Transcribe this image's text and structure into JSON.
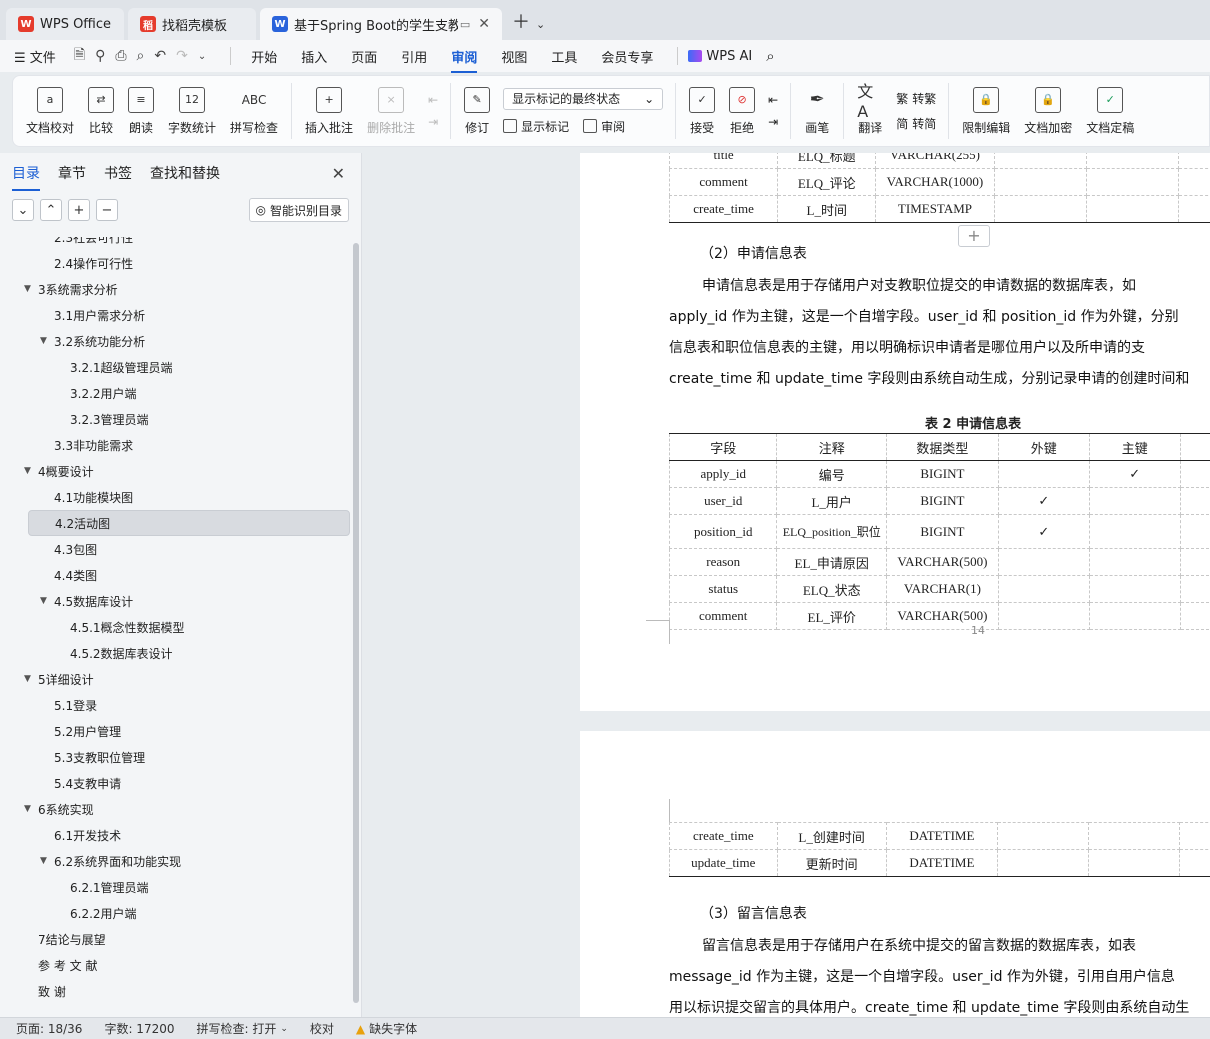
{
  "tabs": [
    {
      "label": "WPS Office",
      "logo": "W",
      "color": "#e53b2c"
    },
    {
      "label": "找稻壳模板",
      "logo": "稻",
      "color": "#e53b2c"
    },
    {
      "label": "基于Spring Boot的学生支教",
      "logo": "W",
      "color": "#2a63db"
    }
  ],
  "menu": {
    "file": "文件",
    "items": [
      "开始",
      "插入",
      "页面",
      "引用",
      "审阅",
      "视图",
      "工具",
      "会员专享"
    ],
    "active": "审阅",
    "ai": "WPS AI"
  },
  "ribbon": {
    "proofread": "文档校对",
    "compare": "比较",
    "read_aloud": "朗读",
    "word_count": "字数统计",
    "word_count_icon": "12",
    "spell_check": "拼写检查",
    "spell_icon": "ABC",
    "insert_comment": "插入批注",
    "delete_comment": "删除批注",
    "revise": "修订",
    "show_markup_select": "显示标记的最终状态",
    "show_markup": "显示标记",
    "review": "审阅",
    "accept": "接受",
    "reject": "拒绝",
    "pen": "画笔",
    "translate": "翻译",
    "to_traditional": "转繁",
    "to_simplified": "转简",
    "restrict_edit": "限制编辑",
    "encrypt": "文档加密",
    "finalize": "文档定稿"
  },
  "left_panel": {
    "tabs": [
      "目录",
      "章节",
      "书签",
      "查找和替换"
    ],
    "active": "目录",
    "smart_toc": "智能识别目录",
    "toc": [
      {
        "text": "2.3社会可行性",
        "level": 2
      },
      {
        "text": "2.4操作可行性",
        "level": 2
      },
      {
        "text": "3系统需求分析",
        "level": 1,
        "expanded": true
      },
      {
        "text": "3.1用户需求分析",
        "level": 2
      },
      {
        "text": "3.2系统功能分析",
        "level": 2,
        "expanded": true
      },
      {
        "text": "3.2.1超级管理员端",
        "level": 3
      },
      {
        "text": "3.2.2用户端",
        "level": 3
      },
      {
        "text": "3.2.3管理员端",
        "level": 3
      },
      {
        "text": "3.3非功能需求",
        "level": 2
      },
      {
        "text": "4概要设计",
        "level": 1,
        "expanded": true
      },
      {
        "text": "4.1功能模块图",
        "level": 2
      },
      {
        "text": "4.2活动图",
        "level": 2,
        "selected": true
      },
      {
        "text": "4.3包图",
        "level": 2
      },
      {
        "text": "4.4类图",
        "level": 2
      },
      {
        "text": "4.5数据库设计",
        "level": 2,
        "expanded": true
      },
      {
        "text": "4.5.1概念性数据模型",
        "level": 3
      },
      {
        "text": "4.5.2数据库表设计",
        "level": 3
      },
      {
        "text": "5详细设计",
        "level": 1,
        "expanded": true
      },
      {
        "text": "5.1登录",
        "level": 2
      },
      {
        "text": "5.2用户管理",
        "level": 2
      },
      {
        "text": "5.3支教职位管理",
        "level": 2
      },
      {
        "text": "5.4支教申请",
        "level": 2
      },
      {
        "text": "6系统实现",
        "level": 1,
        "expanded": true
      },
      {
        "text": "6.1开发技术",
        "level": 2
      },
      {
        "text": "6.2系统界面和功能实现",
        "level": 2,
        "expanded": true
      },
      {
        "text": "6.2.1管理员端",
        "level": 3
      },
      {
        "text": "6.2.2用户端",
        "level": 3
      },
      {
        "text": "7结论与展望",
        "level": 1
      },
      {
        "text": "参 考 文 献",
        "level": 1
      },
      {
        "text": "致        谢",
        "level": 1
      }
    ]
  },
  "document": {
    "table1_rows": [
      [
        "title",
        "ELQ_标题",
        "VARCHAR(255)"
      ],
      [
        "comment",
        "ELQ_评论",
        "VARCHAR(1000)"
      ],
      [
        "create_time",
        "L_时间",
        "TIMESTAMP"
      ]
    ],
    "section2_heading": "（2）申请信息表",
    "section2_para": [
      "申请信息表是用于存储用户对支教职位提交的申请数据的数据库表，如",
      "apply_id 作为主键，这是一个自增字段。user_id 和 position_id 作为外键，分别",
      "信息表和职位信息表的主键，用以明确标识申请者是哪位用户以及所申请的支",
      "create_time 和 update_time 字段则由系统自动生成，分别记录申请的创建时间和"
    ],
    "table2_caption": "表 2  申请信息表",
    "table2_headers": [
      "字段",
      "注释",
      "数据类型",
      "外键",
      "主键"
    ],
    "table2_rows": [
      [
        "apply_id",
        "编号",
        "BIGINT",
        "",
        "✓"
      ],
      [
        "user_id",
        "L_用户",
        "BIGINT",
        "✓",
        ""
      ],
      [
        "position_id",
        "ELQ_position_职位",
        "BIGINT",
        "✓",
        ""
      ],
      [
        "reason",
        "EL_申请原因",
        "VARCHAR(500)",
        "",
        ""
      ],
      [
        "status",
        "ELQ_状态",
        "VARCHAR(1)",
        "",
        ""
      ],
      [
        "comment",
        "EL_评价",
        "VARCHAR(500)",
        "",
        ""
      ]
    ],
    "page_number": "14",
    "table2_cont_rows": [
      [
        "create_time",
        "L_创建时间",
        "DATETIME"
      ],
      [
        "update_time",
        "更新时间",
        "DATETIME"
      ]
    ],
    "section3_heading": "（3）留言信息表",
    "section3_para": [
      "留言信息表是用于存储用户在系统中提交的留言数据的数据库表，如表",
      "message_id 作为主键，这是一个自增字段。user_id 作为外键，引用自用户信息",
      "用以标识提交留言的具体用户。create_time 和 update_time 字段则由系统自动生"
    ]
  },
  "status": {
    "page": "页面: 18/36",
    "words": "字数: 17200",
    "spell": "拼写检查: 打开",
    "proof": "校对",
    "missing_font": "缺失字体"
  }
}
